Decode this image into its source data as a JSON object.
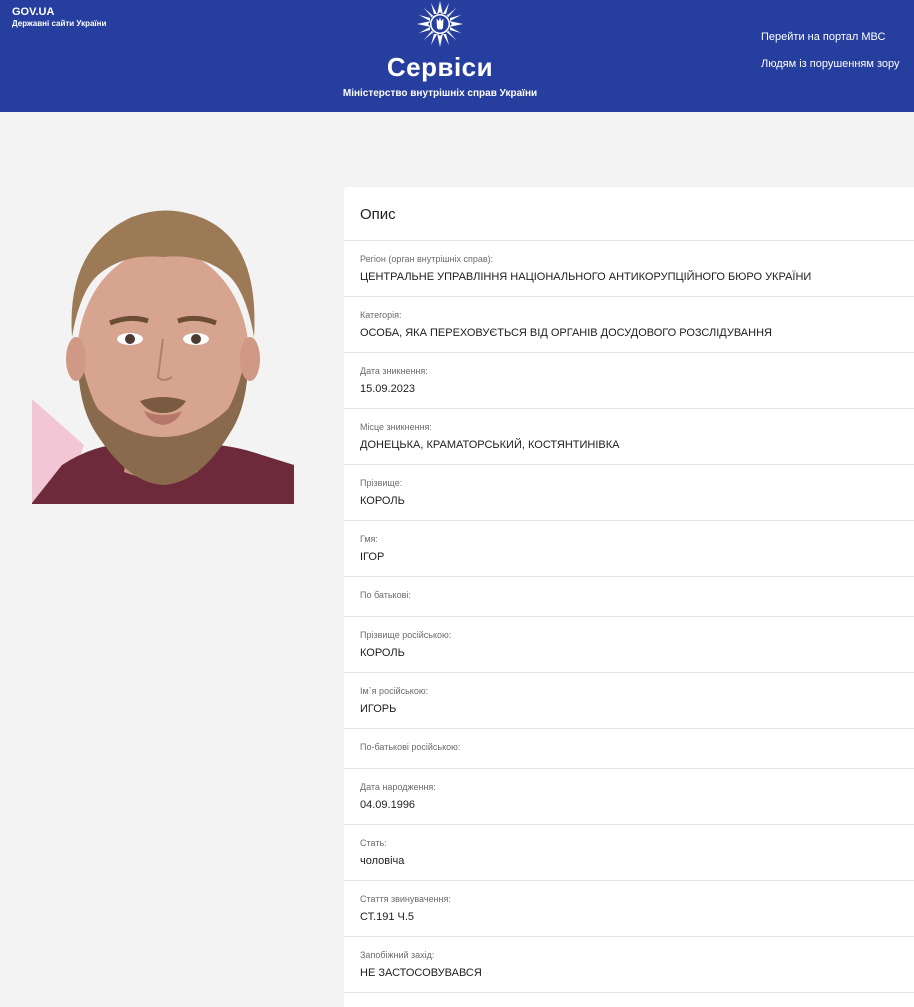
{
  "header": {
    "gov_title": "GOV.UA",
    "gov_subtitle": "Державні сайти України",
    "service_title": "Сервіси",
    "ministry": "Міністерство внутрішніх справ України",
    "links": [
      "Перейти на портал МВС",
      "Людям із порушенням зору"
    ],
    "bg_color": "#263e9d"
  },
  "card": {
    "title": "Опис",
    "fields": [
      {
        "label": "Регіон (орган внутрішніх справ):",
        "value": "ЦЕНТРАЛЬНЕ УПРАВЛІННЯ НАЦІОНАЛЬНОГО АНТИКОРУПЦІЙНОГО БЮРО УКРАЇНИ"
      },
      {
        "label": "Категорія:",
        "value": "ОСОБА, ЯКА ПЕРЕХОВУЄТЬСЯ ВІД ОРГАНІВ ДОСУДОВОГО РОЗСЛІДУВАННЯ"
      },
      {
        "label": "Дата зникнення:",
        "value": "15.09.2023"
      },
      {
        "label": "Місце зникнення:",
        "value": "ДОНЕЦЬКА, КРАМАТОРСЬКИЙ, КОСТЯНТИНІВКА"
      },
      {
        "label": "Прізвище:",
        "value": "КОРОЛЬ"
      },
      {
        "label": "Гмя:",
        "value": "ІГОР"
      },
      {
        "label": "По батькові:",
        "value": ""
      },
      {
        "label": "Прізвище російською:",
        "value": "КОРОЛЬ"
      },
      {
        "label": "Ім`я російською:",
        "value": "ИГОРЬ"
      },
      {
        "label": "По-батькові російською:",
        "value": ""
      },
      {
        "label": "Дата народження:",
        "value": "04.09.1996"
      },
      {
        "label": "Стать:",
        "value": "чоловіча"
      },
      {
        "label": "Стаття звинувачення:",
        "value": "СТ.191 Ч.5"
      },
      {
        "label": "Запобіжний захід:",
        "value": "НЕ ЗАСТОСОВУВАВСЯ"
      }
    ]
  },
  "icons": {
    "emblem": "mvs-star-emblem-icon",
    "photo": "person-photo"
  }
}
